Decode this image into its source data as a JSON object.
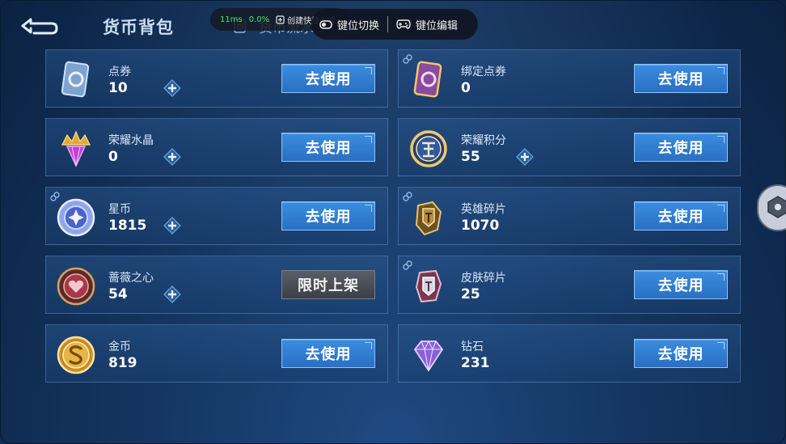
{
  "header": {
    "title": "货币背包",
    "flow_tab": "货币流水",
    "back_icon": "back-arrow-icon"
  },
  "overlay": {
    "latency": "11ms",
    "loss": "0.0%",
    "shortcut": "创建快捷方式",
    "keymap_switch": "键位切换",
    "keymap_edit": "键位编辑"
  },
  "cards": [
    {
      "name": "点券",
      "value": "10",
      "action": "去使用",
      "icon": "voucher-icon"
    },
    {
      "name": "绑定点券",
      "value": "0",
      "action": "去使用",
      "icon": "bound-voucher-icon"
    },
    {
      "name": "荣耀水晶",
      "value": "0",
      "action": "去使用",
      "icon": "crystal-icon"
    },
    {
      "name": "荣耀积分",
      "value": "55",
      "action": "去使用",
      "icon": "points-icon"
    },
    {
      "name": "星币",
      "value": "1815",
      "action": "去使用",
      "icon": "star-coin-icon"
    },
    {
      "name": "英雄碎片",
      "value": "1070",
      "action": "去使用",
      "icon": "hero-fragment-icon"
    },
    {
      "name": "蔷薇之心",
      "value": "54",
      "action": "限时上架",
      "icon": "rose-heart-icon"
    },
    {
      "name": "皮肤碎片",
      "value": "25",
      "action": "去使用",
      "icon": "skin-fragment-icon"
    },
    {
      "name": "金币",
      "value": "819",
      "action": "去使用",
      "icon": "gold-coin-icon"
    },
    {
      "name": "钻石",
      "value": "231",
      "action": "去使用",
      "icon": "diamond-icon"
    }
  ],
  "colors": {
    "background": "#143560",
    "button": "#2f7bd2",
    "disabled_button": "#4a4e55"
  }
}
